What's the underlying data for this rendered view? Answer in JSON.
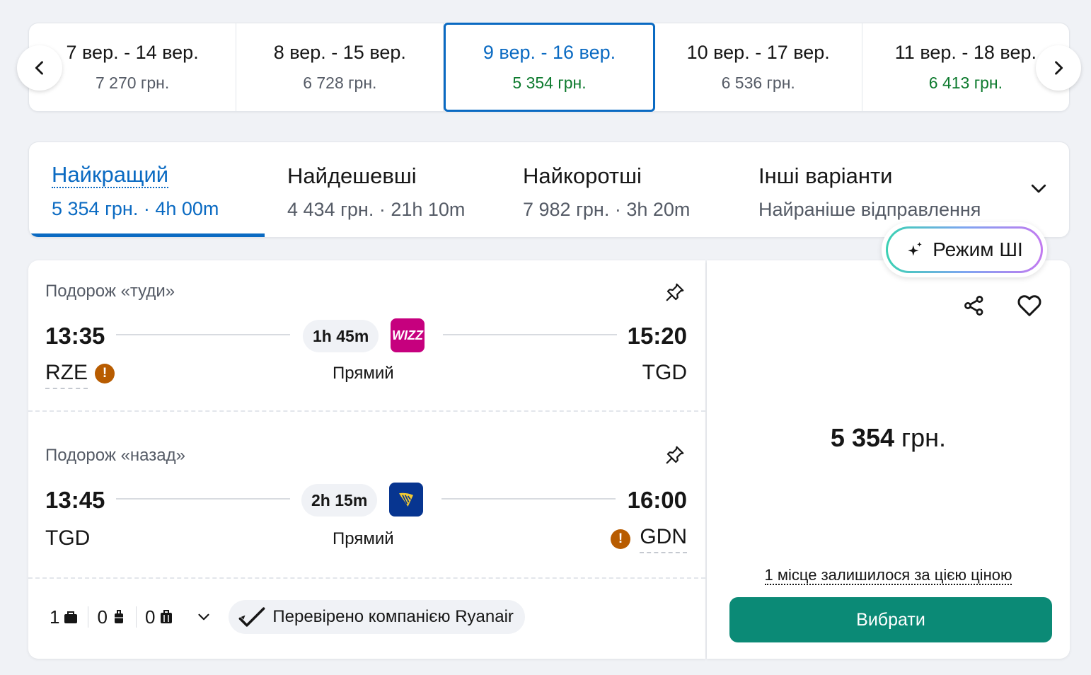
{
  "date_strip": {
    "cells": [
      {
        "range": "7 вер. - 14 вер.",
        "price": "7 270 грн."
      },
      {
        "range": "8 вер. - 15 вер.",
        "price": "6 728 грн."
      },
      {
        "range": "9 вер. - 16 вер.",
        "price": "5 354 грн."
      },
      {
        "range": "10 вер. - 17 вер.",
        "price": "6 536 грн."
      },
      {
        "range": "11 вер. - 18 вер.",
        "price": "6 413 грн."
      }
    ],
    "selected_index": 2
  },
  "sort_tabs": [
    {
      "title": "Найкращий",
      "sub": "5 354 грн. · 4h 00m"
    },
    {
      "title": "Найдешевші",
      "sub": "4 434 грн. · 21h 10m"
    },
    {
      "title": "Найкоротші",
      "sub": "7 982 грн. · 3h 20m"
    },
    {
      "title": "Інші варіанти",
      "sub": "Найраніше відправлення"
    }
  ],
  "ai_mode": {
    "label": "Режим ШІ"
  },
  "result": {
    "outbound": {
      "label": "Подорож «туди»",
      "depart_time": "13:35",
      "arrive_time": "15:20",
      "from": "RZE",
      "to": "TGD",
      "duration": "1h 45m",
      "airline_logo_text": "WIZZ",
      "stops": "Прямий",
      "warning": "!"
    },
    "inbound": {
      "label": "Подорож «назад»",
      "depart_time": "13:45",
      "arrive_time": "16:00",
      "from": "TGD",
      "to": "GDN",
      "duration": "2h 15m",
      "stops": "Прямий",
      "warning": "!"
    },
    "bags": {
      "personal": "1",
      "carry_on": "0",
      "checked": "0"
    },
    "verified": "Перевірено компанією Ryanair",
    "price": "5 354",
    "currency": " грн.",
    "seats_left": "1 місце залишилося за цією ціною",
    "select_label": "Вибрати"
  },
  "colors": {
    "accent": "#0a6ac2",
    "green": "#0d7a2e",
    "select_button": "#0b8a76",
    "wizz": "#c6007e",
    "ryanair": "#073590",
    "warning": "#b85c00"
  }
}
